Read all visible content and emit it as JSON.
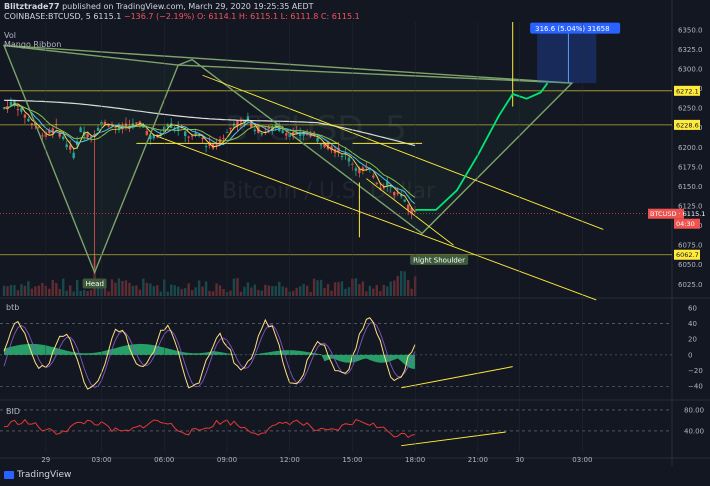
{
  "header": {
    "author": "Blitztrade77",
    "published_text": "published on TradingView.com, March 29, 2020 19:25:35 AEDT",
    "symbol": "COINBASE:BTCUSD, 5",
    "last": "6115.1",
    "change": "−136.7 (−2.19%)",
    "ohlc": "O: 6114.1  H: 6115.1  L: 6111.8  C: 6115.1",
    "indicator1": "Vol",
    "indicator2": "Mango Ribbon"
  },
  "watermark": {
    "symbol": "BTCUSD, 5",
    "name": "Bitcoin / U.S. Dollar"
  },
  "annotations": {
    "head": "Head",
    "right_shoulder": "Right Shoulder",
    "measure": "316.6 (5.04%) 31658"
  },
  "price_axis": {
    "ticks": [
      "6350.0",
      "6325.0",
      "6300.0",
      "6275.0",
      "6250.0",
      "6225.0",
      "6200.0",
      "6175.0",
      "6150.0",
      "6125.0",
      "6100.0",
      "6075.0",
      "6050.0",
      "6025.0"
    ],
    "badges": [
      {
        "label": "6272.1",
        "color": "#ffeb3b",
        "text_color": "#131722"
      },
      {
        "label": "6228.6",
        "color": "#ffeb3b",
        "text_color": "#131722"
      },
      {
        "label": "BTCUSD · 6115.1",
        "color": "#ef5350",
        "text_color": "#ffffff"
      },
      {
        "label": "04:30",
        "color": "#ef5350",
        "text_color": "#ffffff"
      },
      {
        "label": "6062.7",
        "color": "#ffeb3b",
        "text_color": "#131722"
      }
    ]
  },
  "panes": {
    "btb": {
      "label": "btb",
      "ticks": [
        "60",
        "40",
        "20",
        "0",
        "−20",
        "−40"
      ]
    },
    "bid": {
      "label": "BID",
      "ticks": [
        "80.00",
        "40.00"
      ]
    }
  },
  "time_axis": {
    "ticks": [
      "29",
      "03:00",
      "06:00",
      "09:00",
      "12:00",
      "15:00",
      "18:00",
      "21:00",
      "30",
      "03:00"
    ]
  },
  "footer": {
    "brand": "TradingView"
  },
  "chart_data": {
    "type": "candlestick",
    "symbol": "COINBASE:BTCUSD",
    "interval": "5",
    "price_ylim": [
      6010,
      6360
    ],
    "last_price": 6115.1,
    "change": -136.7,
    "change_pct": -2.19,
    "horizontal_levels": [
      6272.1,
      6228.6,
      6062.7
    ],
    "price_path": [
      [
        0,
        6250
      ],
      [
        3,
        6258
      ],
      [
        6,
        6240
      ],
      [
        9,
        6228
      ],
      [
        12,
        6215
      ],
      [
        15,
        6225
      ],
      [
        18,
        6205
      ],
      [
        20,
        6190
      ],
      [
        22,
        6222
      ],
      [
        25,
        6215
      ],
      [
        28,
        6230
      ],
      [
        30,
        6232
      ],
      [
        33,
        6222
      ],
      [
        36,
        6228
      ],
      [
        40,
        6228
      ],
      [
        42,
        6213
      ],
      [
        44,
        6212
      ],
      [
        47,
        6230
      ],
      [
        50,
        6225
      ],
      [
        52,
        6218
      ],
      [
        54,
        6212
      ],
      [
        56,
        6215
      ],
      [
        58,
        6205
      ],
      [
        60,
        6200
      ],
      [
        62,
        6210
      ],
      [
        64,
        6218
      ],
      [
        66,
        6232
      ],
      [
        68,
        6230
      ],
      [
        70,
        6235
      ],
      [
        72,
        6225
      ],
      [
        74,
        6220
      ],
      [
        76,
        6222
      ],
      [
        78,
        6225
      ],
      [
        80,
        6222
      ],
      [
        82,
        6218
      ],
      [
        84,
        6215
      ],
      [
        86,
        6216
      ],
      [
        88,
        6218
      ],
      [
        90,
        6210
      ],
      [
        92,
        6205
      ],
      [
        94,
        6200
      ],
      [
        96,
        6195
      ],
      [
        98,
        6190
      ],
      [
        100,
        6180
      ],
      [
        102,
        6170
      ],
      [
        104,
        6172
      ],
      [
        106,
        6165
      ],
      [
        108,
        6150
      ],
      [
        110,
        6155
      ],
      [
        112,
        6143
      ],
      [
        114,
        6135
      ],
      [
        116,
        6122
      ],
      [
        118,
        6115
      ]
    ],
    "spike_low": [
      26,
      6045
    ],
    "projection": [
      [
        118,
        6120
      ],
      [
        124,
        6120
      ],
      [
        130,
        6145
      ],
      [
        136,
        6190
      ],
      [
        142,
        6240
      ],
      [
        146,
        6268
      ],
      [
        150,
        6262
      ],
      [
        154,
        6270
      ],
      [
        156,
        6282
      ]
    ],
    "btb": {
      "ylim": [
        -55,
        70
      ],
      "series": "oscillator"
    },
    "bid": {
      "ylim": [
        0,
        95
      ],
      "levels": [
        80,
        40
      ]
    }
  }
}
